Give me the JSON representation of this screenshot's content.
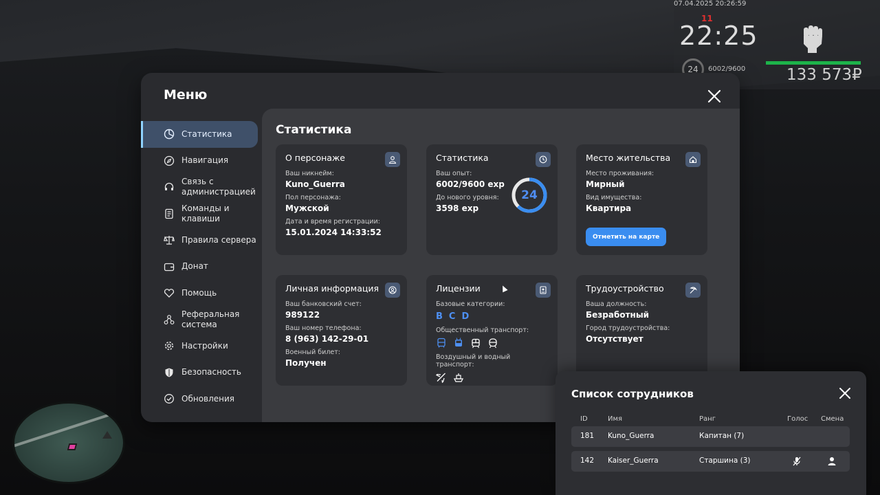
{
  "hud": {
    "date": "07.04.2025 20:26:59",
    "mark": "11",
    "time": "22:25",
    "level": "24",
    "exp": "6002/9600",
    "money": "133 573₽"
  },
  "menu": {
    "title": "Меню",
    "content_title": "Статистика",
    "sidebar": [
      {
        "label": "Статистика",
        "icon": "pie-chart-icon",
        "active": true
      },
      {
        "label": "Навигация",
        "icon": "compass-icon"
      },
      {
        "label": "Связь с администрацией",
        "icon": "headset-icon"
      },
      {
        "label": "Команды и клавиши",
        "icon": "document-icon"
      },
      {
        "label": "Правила сервера",
        "icon": "scales-icon"
      },
      {
        "label": "Донат",
        "icon": "wallet-icon"
      },
      {
        "label": "Помощь",
        "icon": "heart-hand-icon"
      },
      {
        "label": "Реферальная система",
        "icon": "network-icon"
      },
      {
        "label": "Настройки",
        "icon": "gear-icon"
      },
      {
        "label": "Безопасность",
        "icon": "shield-icon"
      },
      {
        "label": "Обновления",
        "icon": "check-circle-icon"
      }
    ],
    "cards": {
      "character": {
        "title": "О персонаже",
        "nick_label": "Ваш никнейм:",
        "nick": "Kuno_Guerra",
        "gender_label": "Пол персонажа:",
        "gender": "Мужской",
        "reg_label": "Дата и время регистрации:",
        "reg": "15.01.2024 14:33:52"
      },
      "stats": {
        "title": "Статистика",
        "exp_label": "Ваш опыт:",
        "exp": "6002/9600 exp",
        "next_label": "До нового уровня:",
        "next": "3598 exp",
        "level": "24",
        "progress": 0.625
      },
      "residence": {
        "title": "Место жительства",
        "place_label": "Место проживания:",
        "place": "Мирный",
        "property_label": "Вид имущества:",
        "property": "Квартира",
        "button": "Отметить на карте"
      },
      "personal": {
        "title": "Личная информация",
        "bank_label": "Ваш банковский счет:",
        "bank": "989122",
        "phone_label": "Ваш номер телефона:",
        "phone": "8 (963) 142-29-01",
        "military_label": "Военный билет:",
        "military": "Получен"
      },
      "licenses": {
        "title": "Лицензии",
        "base_label": "Базовые категории:",
        "base": [
          "B",
          "C",
          "D"
        ],
        "public_label": "Общественный транспорт:",
        "air_label": "Воздушный и водный транспорт:"
      },
      "employment": {
        "title": "Трудоустройство",
        "position_label": "Ваша должность:",
        "position": "Безработный",
        "city_label": "Город трудоустройства:",
        "city": "Отсутствует"
      }
    }
  },
  "staff": {
    "title": "Список сотрудников",
    "headers": {
      "id": "ID",
      "name": "Имя",
      "rank": "Ранг",
      "voice": "Голос",
      "shift": "Смена"
    },
    "rows": [
      {
        "id": "181",
        "name": "Kuno_Guerra",
        "rank": "Капитан (7)"
      },
      {
        "id": "142",
        "name": "Kaiser_Guerra",
        "rank": "Старшина (3)"
      }
    ]
  },
  "colors": {
    "accent": "#3a8df0",
    "active": "#3f5069",
    "health": "#1db34a"
  }
}
